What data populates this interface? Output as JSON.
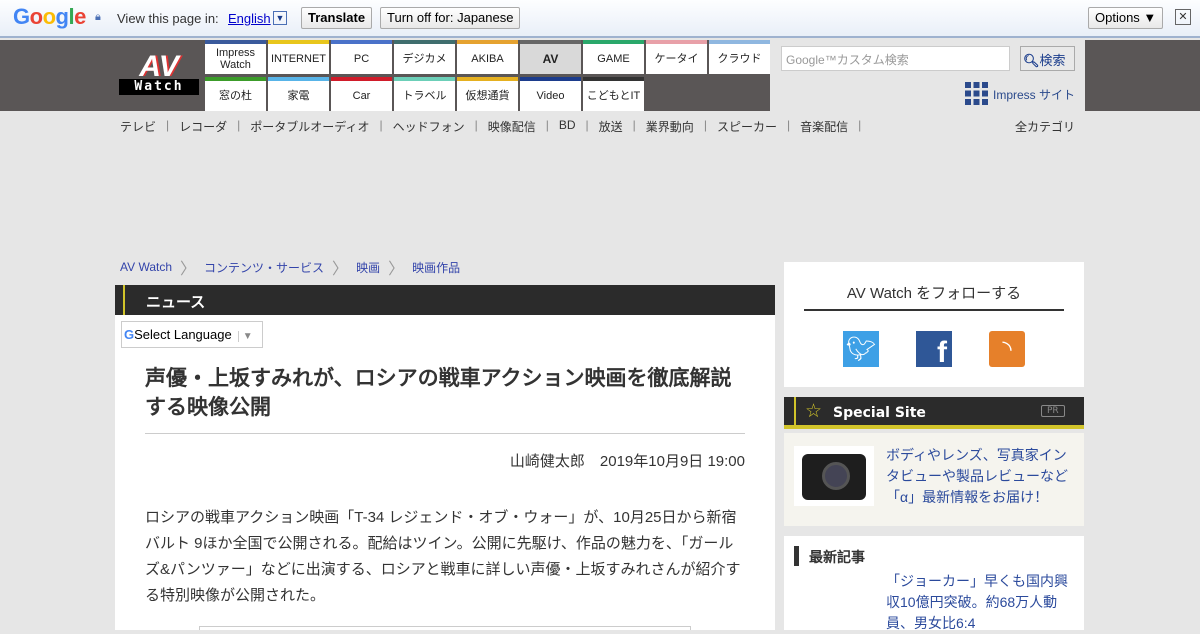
{
  "translate_bar": {
    "brand": "Google",
    "prompt": "View this page in:",
    "language": "English",
    "translate": "Translate",
    "turn_off": "Turn off for: Japanese",
    "options": "Options ▼",
    "close": "✕"
  },
  "header": {
    "logo_top": "AV",
    "logo_bottom": "Watch",
    "tabs_row1": [
      "Impress Watch",
      "INTERNET",
      "PC",
      "デジカメ",
      "AKIBA",
      "AV",
      "GAME",
      "ケータイ",
      "クラウド"
    ],
    "tabs_row2": [
      "窓の杜",
      "家電",
      "Car",
      "トラベル",
      "仮想通貨",
      "Video",
      "こどもとIT"
    ],
    "search_placeholder": "Google™カスタム検索",
    "search_button": "検索",
    "impress_sites": "Impress サイト"
  },
  "colors": {
    "row1": [
      "#3a5a9c",
      "#e8c61c",
      "#4a72c9",
      "#3f6e6e",
      "#e5a230",
      "#666666",
      "#2aa86b",
      "#e8a0a8",
      "#8fb7e0"
    ],
    "row2": [
      "#3c9c2a",
      "#58b4e8",
      "#d01c2a",
      "#6ccfb8",
      "#e5b020",
      "#1c3c8c",
      "#333333"
    ]
  },
  "categories": [
    "テレビ",
    "レコーダ",
    "ポータブルオーディオ",
    "ヘッドフォン",
    "映像配信",
    "BD",
    "放送",
    "業界動向",
    "スピーカー",
    "音楽配信"
  ],
  "all_categories": "全カテゴリ",
  "breadcrumb": [
    "AV Watch",
    "コンテンツ・サービス",
    "映画",
    "映画作品"
  ],
  "article": {
    "section": "ニュース",
    "select_language": "Select Language",
    "title": "声優・上坂すみれが、ロシアの戦車アクション映画を徹底解説する映像公開",
    "byline": "山崎健太郎　2019年10月9日 19:00",
    "body": "ロシアの戦車アクション映画「T-34 レジェンド・オブ・ウォー」が、10月25日から新宿バルト 9ほか全国で公開される。配給はツイン。公開に先駆け、作品の魅力を、「ガールズ&パンツァー」などに出演する、ロシアと戦車に詳しい声優・上坂すみれさんが紹介する特別映像が公開された。"
  },
  "sidebar": {
    "follow_title": "AV Watch をフォローする",
    "special_title": "Special Site",
    "pr": "PR",
    "special_text": "ボディやレンズ、写真家インタビューや製品レビューなど「α」最新情報をお届け！",
    "latest_title": "最新記事",
    "latest_item": "「ジョーカー」早くも国内興収10億円突破。約68万人動員、男女比6:4"
  }
}
